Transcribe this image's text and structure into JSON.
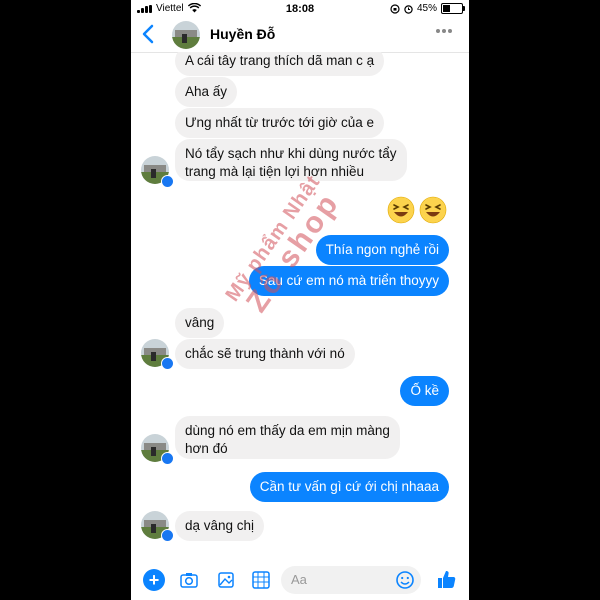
{
  "status": {
    "carrier": "Viettel",
    "time": "18:08",
    "battery": "45%",
    "battery_level": 0.45
  },
  "header": {
    "contact_name": "Huyền Đỗ"
  },
  "messages": [
    {
      "from": "them",
      "text": "A cái tây trang thích dã man c ạ"
    },
    {
      "from": "them",
      "text": "Aha ấy"
    },
    {
      "from": "them",
      "text": "Ưng nhất từ trước tới giờ của e"
    },
    {
      "from": "them",
      "lines": [
        "Nó tẩy sạch như khi dùng nước tẩy",
        "trang mà lại tiện lợi hơn nhiều"
      ]
    },
    {
      "from": "me",
      "emoji": "laughing-emoji"
    },
    {
      "from": "me",
      "text": "Thía ngon nghẻ rồi"
    },
    {
      "from": "me",
      "text": "Sau cứ em nó mà triển thoyyy"
    },
    {
      "from": "them",
      "text": "vâng"
    },
    {
      "from": "them",
      "text": "chắc sẽ trung thành với nó"
    },
    {
      "from": "me",
      "text": "Ố kề"
    },
    {
      "from": "them",
      "lines": [
        "dùng nó em thấy da em mịn màng",
        "hơn đó"
      ]
    },
    {
      "from": "me",
      "text": "Cần tư vấn gì cứ ới chị nhaaa"
    },
    {
      "from": "them",
      "text": "dạ vâng chị"
    }
  ],
  "watermark": {
    "line1": "Mỹ phẩm Nhật",
    "line2": "Zô shop"
  },
  "composer": {
    "placeholder": "Aa"
  },
  "colors": {
    "outgoing": "#0b84ff",
    "incoming": "#f1f0f0",
    "accent": "#0b84ff"
  },
  "icons": [
    "back-chevron-icon",
    "more-icon",
    "plus-icon",
    "camera-icon",
    "gallery-icon",
    "gif-icon",
    "emoji-icon",
    "like-icon",
    "messenger-badge-icon"
  ]
}
